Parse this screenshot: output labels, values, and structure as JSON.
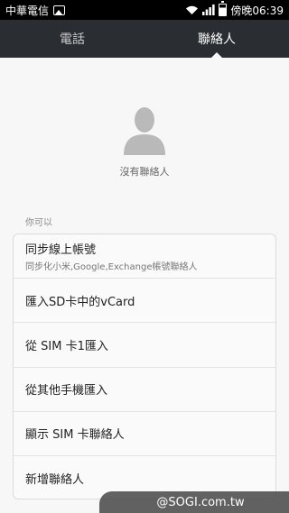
{
  "status_bar": {
    "carrier": "中華電信",
    "time": "傍晚06:39"
  },
  "tabs": [
    {
      "label": "電話"
    },
    {
      "label": "聯絡人"
    }
  ],
  "empty_state": {
    "text": "沒有聯絡人"
  },
  "section_label": "你可以",
  "options": [
    {
      "title": "同步線上帳號",
      "subtitle": "同步化小米,Google,Exchange帳號聯絡人"
    },
    {
      "title": "匯入SD卡中的vCard"
    },
    {
      "title": "從 SIM 卡1匯入"
    },
    {
      "title": "從其他手機匯入"
    },
    {
      "title": "顯示 SIM 卡聯絡人"
    },
    {
      "title": "新增聯絡人"
    }
  ],
  "watermark": "@SOGI.com.tw",
  "icons": {
    "status": [
      "image-icon",
      "wifi-icon",
      "signal-icon",
      "battery-icon"
    ],
    "empty": "person-avatar-icon"
  }
}
